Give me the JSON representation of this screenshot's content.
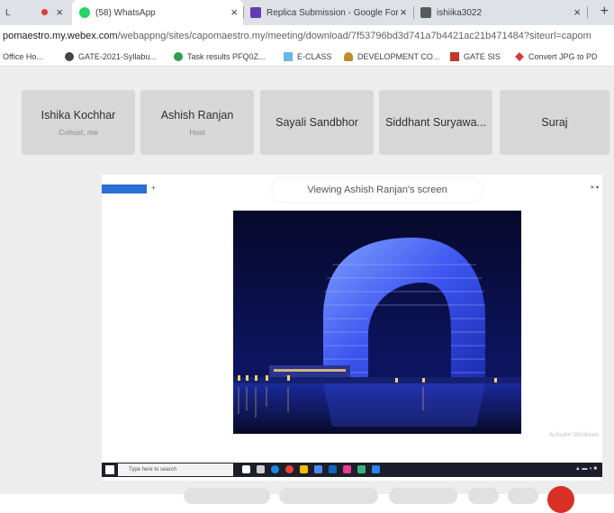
{
  "browser": {
    "tabs": [
      {
        "title": "L",
        "close": "×",
        "favicon_color": "#e53935"
      },
      {
        "title": "(58) WhatsApp",
        "close": "×",
        "favicon_color": "#25d366"
      },
      {
        "title": "Replica Submission - Google For",
        "close": "×",
        "favicon_color": "#673ab7"
      },
      {
        "title": "ishiika3022",
        "close": "×",
        "favicon_color": "#5a5a5a"
      }
    ],
    "new_tab": "+",
    "url_host": "pomaestro.my.webex.com",
    "url_path": "/webappng/sites/capomaestro.my/meeting/download/7f53796bd3d741a7b4421ac21b471484?siteurl=capom",
    "bookmarks": [
      {
        "label": "Office Ho...",
        "color": "#444444"
      },
      {
        "label": "GATE-2021-Syllabu...",
        "color": "#444444"
      },
      {
        "label": "Task results PFQ0Z...",
        "color": "#2e9e4a"
      },
      {
        "label": "E-CLASS",
        "color": "#6cb6e6"
      },
      {
        "label": "DEVELOPMENT CO...",
        "color": "#c28a2d"
      },
      {
        "label": "GATE SIS",
        "color": "#c0392b"
      },
      {
        "label": "Convert JPG to PD",
        "color": "#d63b3b"
      }
    ]
  },
  "participants": [
    {
      "name": "Ishika Kochhar",
      "role": "Cohost, me"
    },
    {
      "name": "Ashish Ranjan",
      "role": "Host"
    },
    {
      "name": "Sayali Sandbhor",
      "role": ""
    },
    {
      "name": "Siddhant Suryawa...",
      "role": ""
    },
    {
      "name": "Suraj",
      "role": ""
    }
  ],
  "shared_screen": {
    "viewing_label": "Viewing Ashish Ranjan's screen",
    "activate_windows": "Activate Windows",
    "taskbar_search": "Type here to search"
  },
  "colors": {
    "webex_bg": "#ededed",
    "card_bg": "#d7d7d7",
    "accent_blue": "#2a6fd6",
    "leave_red": "#d93025"
  }
}
